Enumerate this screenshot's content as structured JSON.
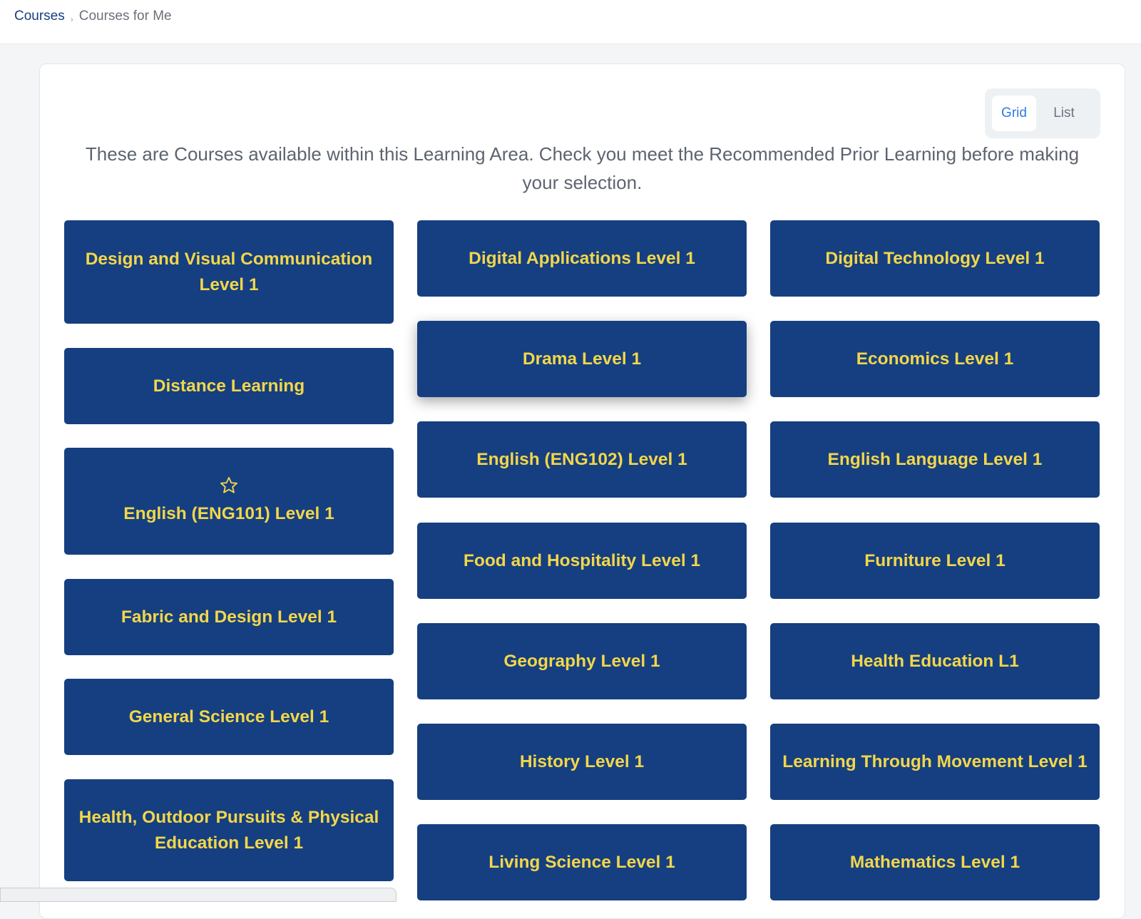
{
  "breadcrumb": {
    "root": "Courses",
    "separator": "›",
    "current": "Courses for Me"
  },
  "view_toggle": {
    "grid_label": "Grid",
    "list_label": "List",
    "active": "Grid"
  },
  "intro_text": "These are Courses available within this Learning Area. Check you meet the Recommended Prior Learning before making your selection.",
  "colors": {
    "tile_background": "#153f80",
    "tile_text": "#f3d64a",
    "toggle_active_text": "#2f7be0"
  },
  "courses": {
    "col1": [
      {
        "label": "Design and Visual Communication Level 1"
      },
      {
        "label": "Distance Learning"
      },
      {
        "label": "English (ENG101) Level 1",
        "icon": "star-outline-icon"
      },
      {
        "label": "Fabric and Design Level 1"
      },
      {
        "label": "General Science Level 1"
      },
      {
        "label": "Health, Outdoor Pursuits & Physical Education Level 1"
      }
    ],
    "col2": [
      {
        "label": "Digital Applications Level 1"
      },
      {
        "label": "Drama Level 1",
        "state": "hovered"
      },
      {
        "label": "English (ENG102) Level 1"
      },
      {
        "label": "Food and Hospitality Level 1"
      },
      {
        "label": "Geography Level 1"
      },
      {
        "label": "History Level 1"
      },
      {
        "label": "Living Science Level 1"
      }
    ],
    "col3": [
      {
        "label": "Digital Technology Level 1"
      },
      {
        "label": "Economics Level 1"
      },
      {
        "label": "English Language Level 1"
      },
      {
        "label": "Furniture Level 1"
      },
      {
        "label": "Health Education L1"
      },
      {
        "label": "Learning Through Movement Level 1"
      },
      {
        "label": "Mathematics Level 1"
      }
    ]
  }
}
